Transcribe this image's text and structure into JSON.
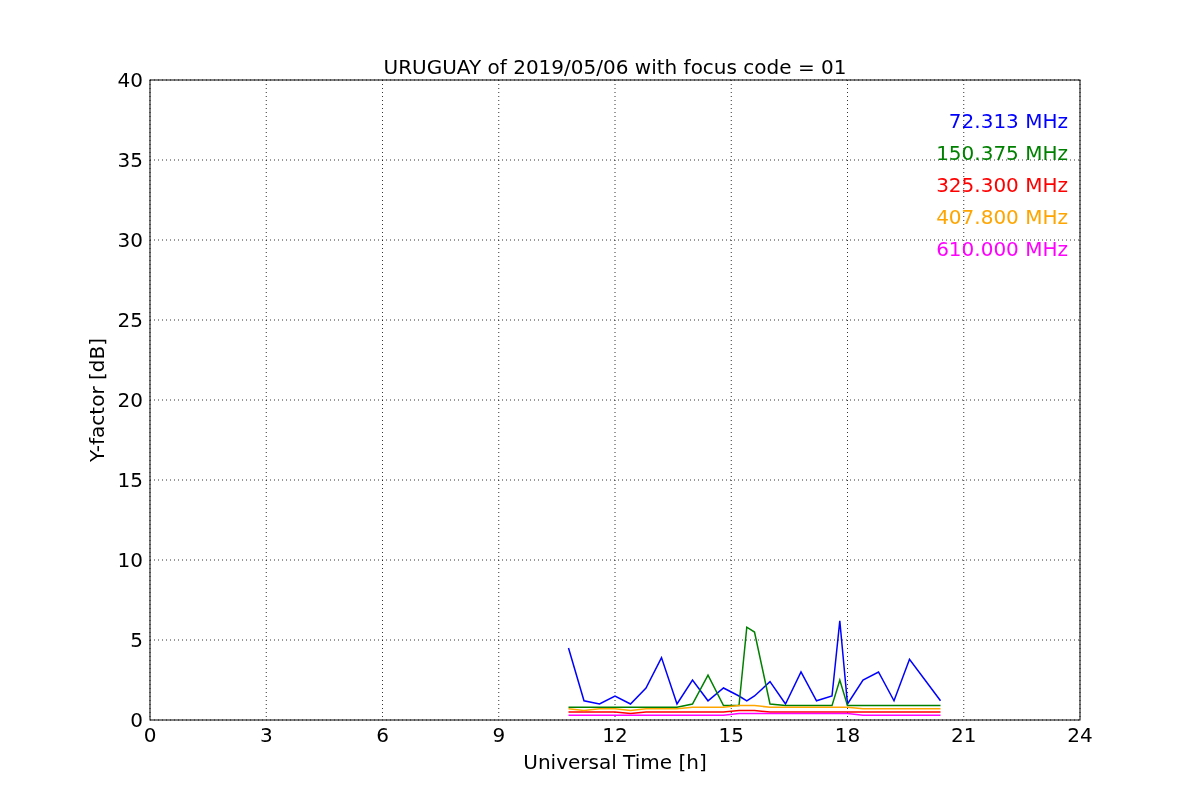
{
  "figure": {
    "chart_data": {
      "type": "line",
      "title": "URUGUAY of 2019/05/06 with focus code = 01",
      "xlabel": "Universal Time [h]",
      "ylabel": "Y-factor [dB]",
      "x": [
        10.8,
        11.2,
        11.6,
        12,
        12.4,
        12.8,
        13.2,
        13.6,
        14,
        14.4,
        14.8,
        15.2,
        15.4,
        15.6,
        16,
        16.4,
        16.8,
        17.2,
        17.6,
        17.8,
        18,
        18.4,
        18.8,
        19.2,
        19.6,
        20,
        20.4
      ],
      "series": [
        {
          "name": "72.313 MHz",
          "color": "#0000ff",
          "values": [
            4.5,
            1.2,
            1.0,
            1.5,
            1.0,
            2.0,
            3.9,
            1.0,
            2.5,
            1.2,
            2.0,
            1.5,
            1.2,
            1.5,
            2.4,
            1.0,
            3.0,
            1.2,
            1.5,
            6.2,
            1.0,
            2.5,
            3.0,
            1.2,
            3.8,
            2.5,
            1.2
          ]
        },
        {
          "name": "150.375 MHz",
          "color": "#008000",
          "values": [
            0.8,
            0.8,
            0.8,
            0.8,
            0.8,
            0.8,
            0.8,
            0.8,
            1.0,
            2.8,
            0.9,
            0.9,
            5.8,
            5.5,
            1.0,
            0.9,
            0.9,
            0.9,
            0.9,
            2.5,
            0.9,
            0.9,
            0.9,
            0.9,
            0.9,
            0.9,
            0.9
          ]
        },
        {
          "name": "325.300 MHz",
          "color": "#ff0000",
          "values": [
            0.5,
            0.5,
            0.5,
            0.5,
            0.4,
            0.5,
            0.5,
            0.5,
            0.5,
            0.5,
            0.5,
            0.6,
            0.6,
            0.6,
            0.5,
            0.5,
            0.5,
            0.5,
            0.5,
            0.5,
            0.5,
            0.5,
            0.5,
            0.5,
            0.5,
            0.5,
            0.5
          ]
        },
        {
          "name": "407.800 MHz",
          "color": "#ffa500",
          "values": [
            0.7,
            0.6,
            0.7,
            0.7,
            0.6,
            0.7,
            0.7,
            0.7,
            0.8,
            0.8,
            0.8,
            0.9,
            0.9,
            0.9,
            0.8,
            0.8,
            0.8,
            0.8,
            0.8,
            0.8,
            0.8,
            0.7,
            0.7,
            0.7,
            0.7,
            0.7,
            0.7
          ]
        },
        {
          "name": "610.000 MHz",
          "color": "#ff00ff",
          "values": [
            0.3,
            0.3,
            0.3,
            0.3,
            0.3,
            0.3,
            0.3,
            0.3,
            0.3,
            0.3,
            0.3,
            0.4,
            0.4,
            0.4,
            0.4,
            0.4,
            0.4,
            0.4,
            0.4,
            0.4,
            0.4,
            0.3,
            0.3,
            0.3,
            0.3,
            0.3,
            0.3
          ]
        }
      ],
      "xlim": [
        0,
        24
      ],
      "ylim": [
        0,
        40
      ],
      "xticks": [
        0,
        3,
        6,
        9,
        12,
        15,
        18,
        21,
        24
      ],
      "yticks": [
        0,
        5,
        10,
        15,
        20,
        25,
        30,
        35,
        40
      ],
      "grid": true
    }
  }
}
